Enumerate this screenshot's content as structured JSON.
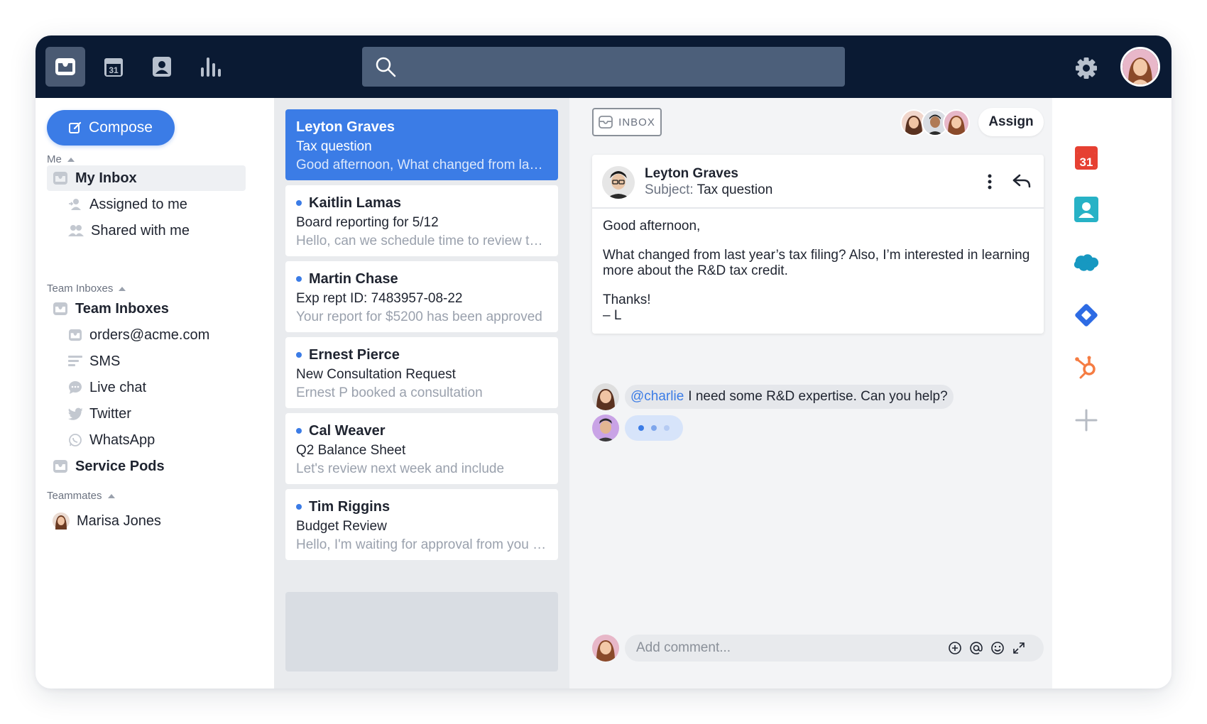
{
  "topbar": {
    "nav": [
      {
        "name": "inbox-icon"
      },
      {
        "name": "calendar-icon",
        "text": "31"
      },
      {
        "name": "contacts-icon"
      },
      {
        "name": "analytics-icon"
      }
    ],
    "search_placeholder": "",
    "settings_icon": "gear-icon"
  },
  "sidebar": {
    "compose_label": "Compose",
    "me_header": "Me",
    "my_inbox": "My Inbox",
    "assigned": "Assigned to me",
    "shared": "Shared with me",
    "team_header": "Team Inboxes",
    "team_inboxes": "Team Inboxes",
    "orders": "orders@acme.com",
    "sms": "SMS",
    "live_chat": "Live chat",
    "twitter": "Twitter",
    "whatsapp": "WhatsApp",
    "service_pods": "Service Pods",
    "teammates_header": "Teammates",
    "teammate": "Marisa Jones"
  },
  "messages": [
    {
      "from": "Leyton Graves",
      "subject": "Tax question",
      "preview": "Good afternoon, What changed from last year's tax filing?",
      "unread": false
    },
    {
      "from": "Kaitlin Lamas",
      "subject": "Board reporting for 5/12",
      "preview": "Hello, can we schedule time to review the board deck?",
      "unread": true
    },
    {
      "from": "Martin Chase",
      "subject": "Exp rept ID: 7483957-08-22",
      "preview": "Your report for $5200 has been approved",
      "unread": true
    },
    {
      "from": "Ernest Pierce",
      "subject": "New Consultation Request",
      "preview": "Ernest P booked a consultation",
      "unread": true
    },
    {
      "from": "Cal Weaver",
      "subject": "Q2 Balance Sheet",
      "preview": "Let's review next week and include",
      "unread": true
    },
    {
      "from": "Tim Riggins",
      "subject": "Budget Review",
      "preview": "Hello, I'm waiting for approval from you on the budget",
      "unread": true
    }
  ],
  "conversation": {
    "tag": "INBOX",
    "assign_label": "Assign",
    "from": "Leyton Graves",
    "subject_label": "Subject:",
    "subject": "Tax question",
    "body": [
      "Good afternoon,",
      "What changed from last year’s tax filing? Also, I’m interested in learning more about the R&D tax credit.",
      "Thanks!",
      "– L"
    ],
    "mention": "@charlie",
    "comment": "I need some R&D expertise. Can you help?",
    "comment_placeholder": "Add comment..."
  },
  "rail": {
    "calendar_text": "31",
    "apps": [
      "calendar-app-icon",
      "contacts-app-icon",
      "salesforce-icon",
      "jira-icon",
      "hubspot-icon",
      "add-integration-icon"
    ]
  },
  "colors": {
    "topbar": "#0a1a33",
    "accent": "#3b7ce6",
    "unread_dot": "#3b7ce6",
    "calendar_red": "#e64032",
    "contacts_teal": "#27b2c6",
    "salesforce_blue": "#1798c1",
    "jira_blue": "#2d6be4",
    "hubspot_orange": "#f57c42"
  }
}
